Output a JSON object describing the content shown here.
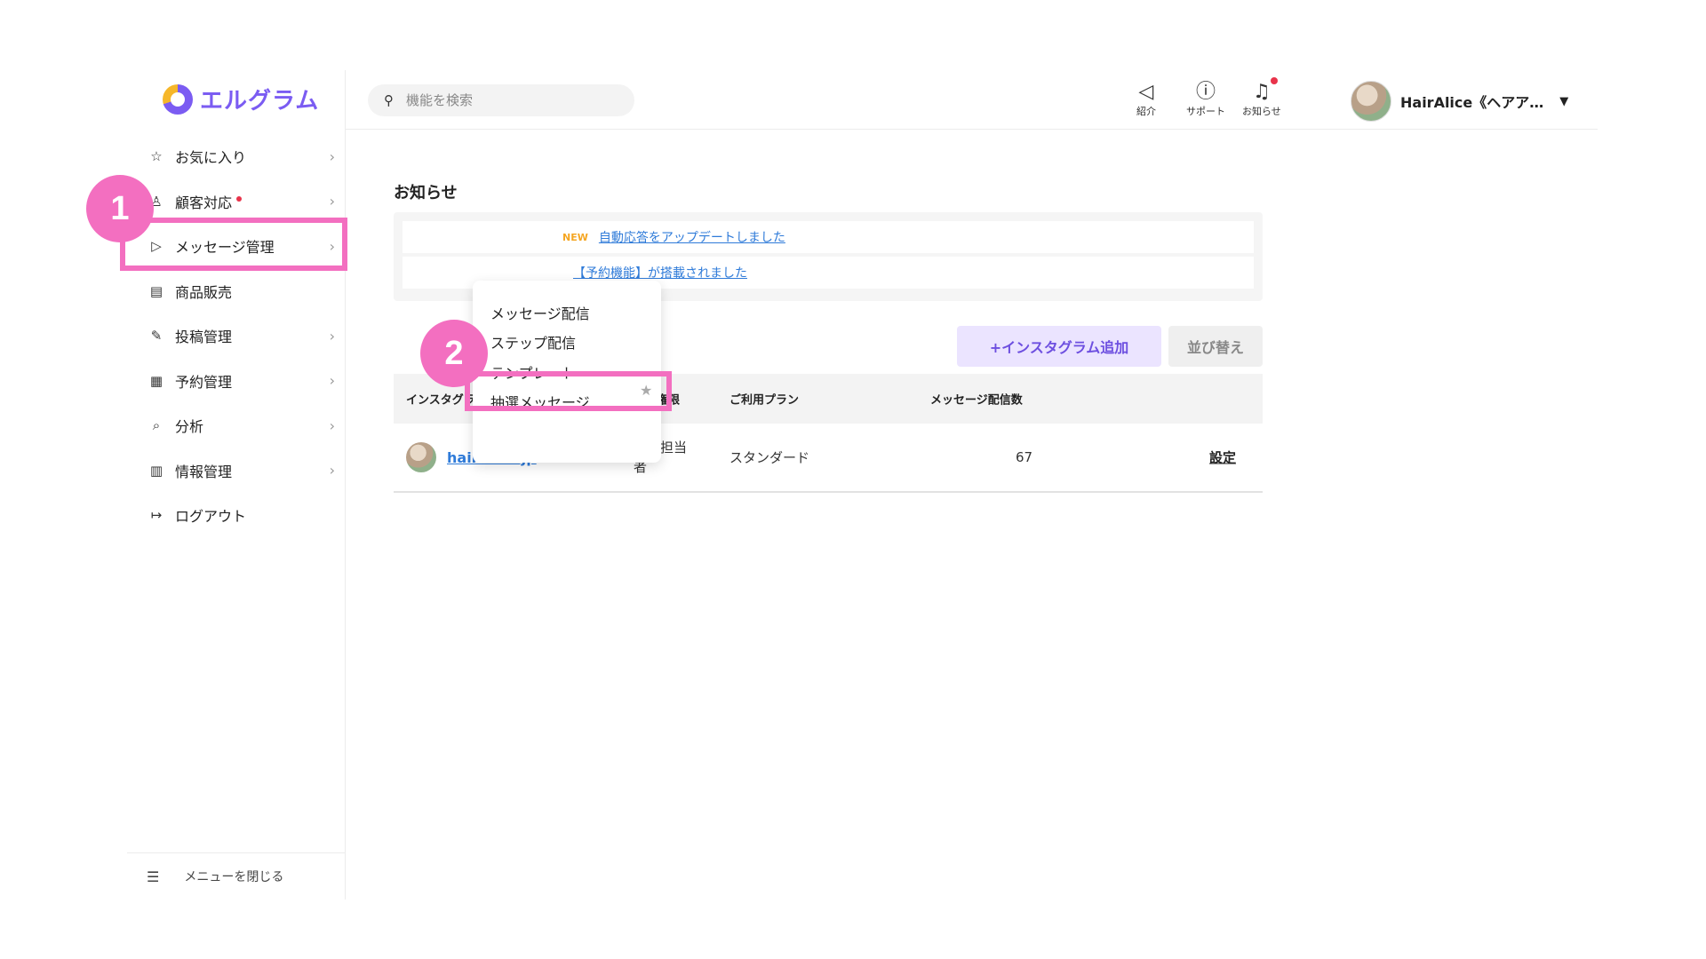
{
  "app": {
    "logo_text": "エルグラム"
  },
  "sidebar": {
    "items": [
      {
        "label": "お気に入り",
        "icon": "star-icon"
      },
      {
        "label": "顧客対応",
        "icon": "user-icon"
      },
      {
        "label": "メッセージ管理",
        "icon": "send-icon"
      },
      {
        "label": "商品販売",
        "icon": "shop-icon"
      },
      {
        "label": "投稿管理",
        "icon": "edit-icon"
      },
      {
        "label": "予約管理",
        "icon": "calendar-icon"
      },
      {
        "label": "分析",
        "icon": "analysis-icon"
      },
      {
        "label": "情報管理",
        "icon": "chart-icon"
      },
      {
        "label": "ログアウト",
        "icon": "logout-icon"
      }
    ],
    "close_menu_label": "メニューを閉じる"
  },
  "header": {
    "search_placeholder": "機能を検索",
    "intro_label": "紹介",
    "support_label": "サポート",
    "notice_label": "お知らせ",
    "user_name": "HairAlice《ヘアア…"
  },
  "main": {
    "news_title": "お知らせ",
    "news": [
      {
        "badge": "NEW",
        "text": "自動応答をアップデートしました"
      },
      {
        "badge": "",
        "text": "【予約機能】が搭載されました"
      }
    ],
    "add_button": "+インスタグラム追加",
    "sort_button": "並び替え",
    "table": {
      "headers": [
        "インスタグラム名",
        "操作権限",
        "ご利用プラン",
        "メッセージ配信数"
      ],
      "rows": [
        {
          "name": "hairalice.jp",
          "role": "運用担当者",
          "plan": "スタンダード",
          "count": "67",
          "settings": "設定"
        }
      ]
    }
  },
  "dropdown": {
    "items": [
      "メッセージ配信",
      "ステップ配信",
      "テンプレート",
      "抽選メッセージ"
    ]
  },
  "annotations": {
    "step1": "1",
    "step2": "2"
  },
  "colors": {
    "accent": "#7b5cf2",
    "highlight": "#f36fc0",
    "link": "#2f7bd9",
    "notification": "#e8334a"
  }
}
